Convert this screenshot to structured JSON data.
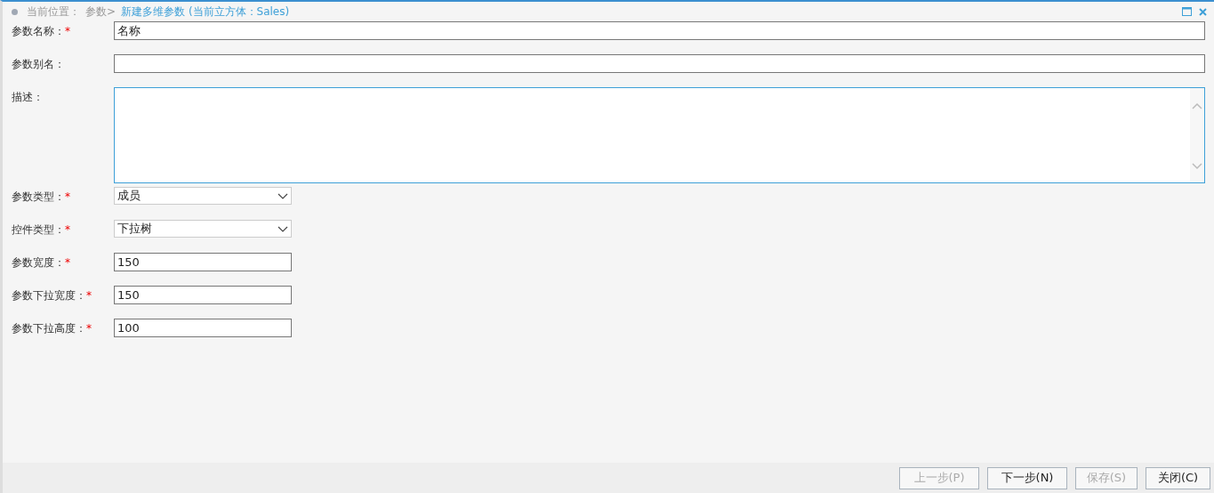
{
  "breadcrumb": {
    "label": "当前位置：",
    "items": [
      {
        "text": "参数>",
        "current": false
      },
      {
        "text": "新建多维参数 (当前立方体：Sales)",
        "current": true
      }
    ]
  },
  "fields": [
    {
      "label": "参数名称：",
      "required_mark": "*",
      "kind": "text",
      "value": "名称"
    },
    {
      "label": "参数别名：",
      "kind": "text"
    },
    {
      "label": "描述：",
      "kind": "textarea"
    },
    {
      "label": "参数类型：",
      "required_mark": "*",
      "kind": "select",
      "value": "成员"
    },
    {
      "label": "控件类型：",
      "required_mark": "*",
      "kind": "select",
      "value": "下拉树"
    },
    {
      "label": "参数宽度：",
      "required_mark": "*",
      "kind": "number",
      "value": "150"
    },
    {
      "label": "参数下拉宽度：",
      "required_mark": "*",
      "kind": "number",
      "value": "150"
    },
    {
      "label": "参数下拉高度：",
      "required_mark": "*",
      "kind": "number",
      "value": "100"
    }
  ],
  "buttons": [
    {
      "label": "上一步(P)",
      "disabled": true
    },
    {
      "label": "下一步(N)",
      "disabled": false
    },
    {
      "label": "保存(S)",
      "disabled": true
    },
    {
      "label": "关闭(C)",
      "disabled": false
    }
  ]
}
